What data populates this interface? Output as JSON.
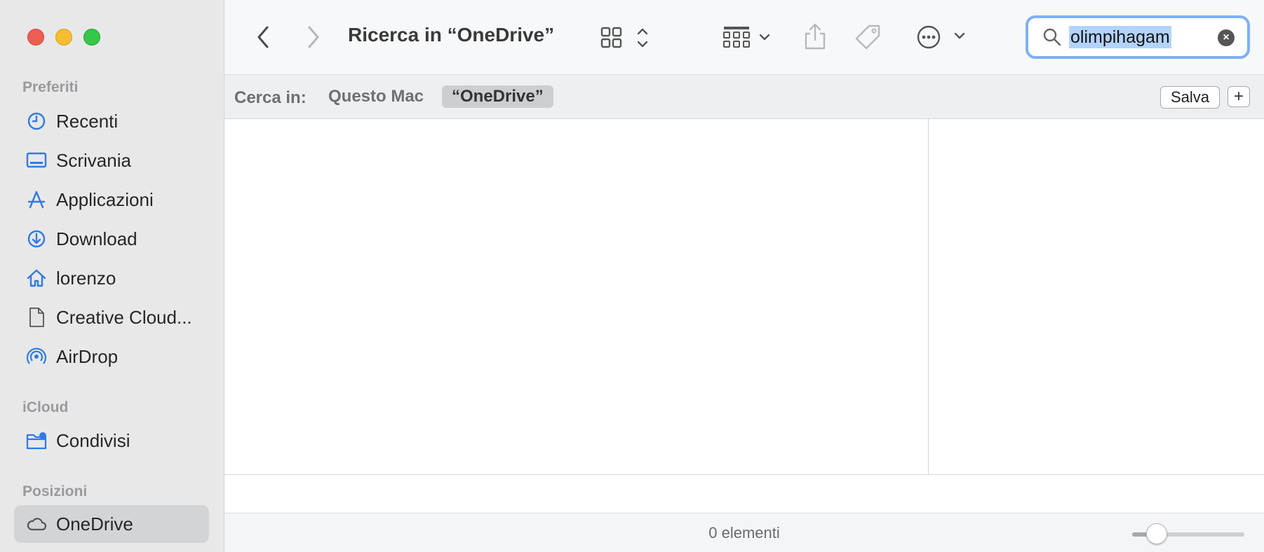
{
  "sidebar": {
    "sections": [
      {
        "title": "Preferiti",
        "items": [
          {
            "label": "Recenti",
            "icon": "clock-icon"
          },
          {
            "label": "Scrivania",
            "icon": "desktop-icon"
          },
          {
            "label": "Applicazioni",
            "icon": "applications-icon"
          },
          {
            "label": "Download",
            "icon": "download-icon"
          },
          {
            "label": "lorenzo",
            "icon": "home-icon"
          },
          {
            "label": "Creative Cloud...",
            "icon": "document-icon"
          },
          {
            "label": "AirDrop",
            "icon": "airdrop-icon"
          }
        ]
      },
      {
        "title": "iCloud",
        "items": [
          {
            "label": "Condivisi",
            "icon": "shared-folder-icon"
          }
        ]
      },
      {
        "title": "Posizioni",
        "items": [
          {
            "label": "OneDrive",
            "icon": "cloud-icon",
            "selected": true
          }
        ]
      }
    ]
  },
  "toolbar": {
    "title": "Ricerca in “OneDrive”",
    "search": {
      "query": "olimpihagam"
    }
  },
  "scopebar": {
    "label": "Cerca in:",
    "options": [
      {
        "label": "Questo Mac",
        "selected": false
      },
      {
        "label": "“OneDrive”",
        "selected": true
      }
    ],
    "save_label": "Salva",
    "add_label": "+"
  },
  "status": {
    "count_text": "0 elementi",
    "zoom_level": 0.22
  },
  "colors": {
    "accent": "#7fb0f5",
    "selection": "#b3d3fb",
    "sidebar_icon": "#2f7ae5",
    "traffic_red": "#ee5d52",
    "traffic_yellow": "#f5bd2f",
    "traffic_green": "#35c748"
  }
}
